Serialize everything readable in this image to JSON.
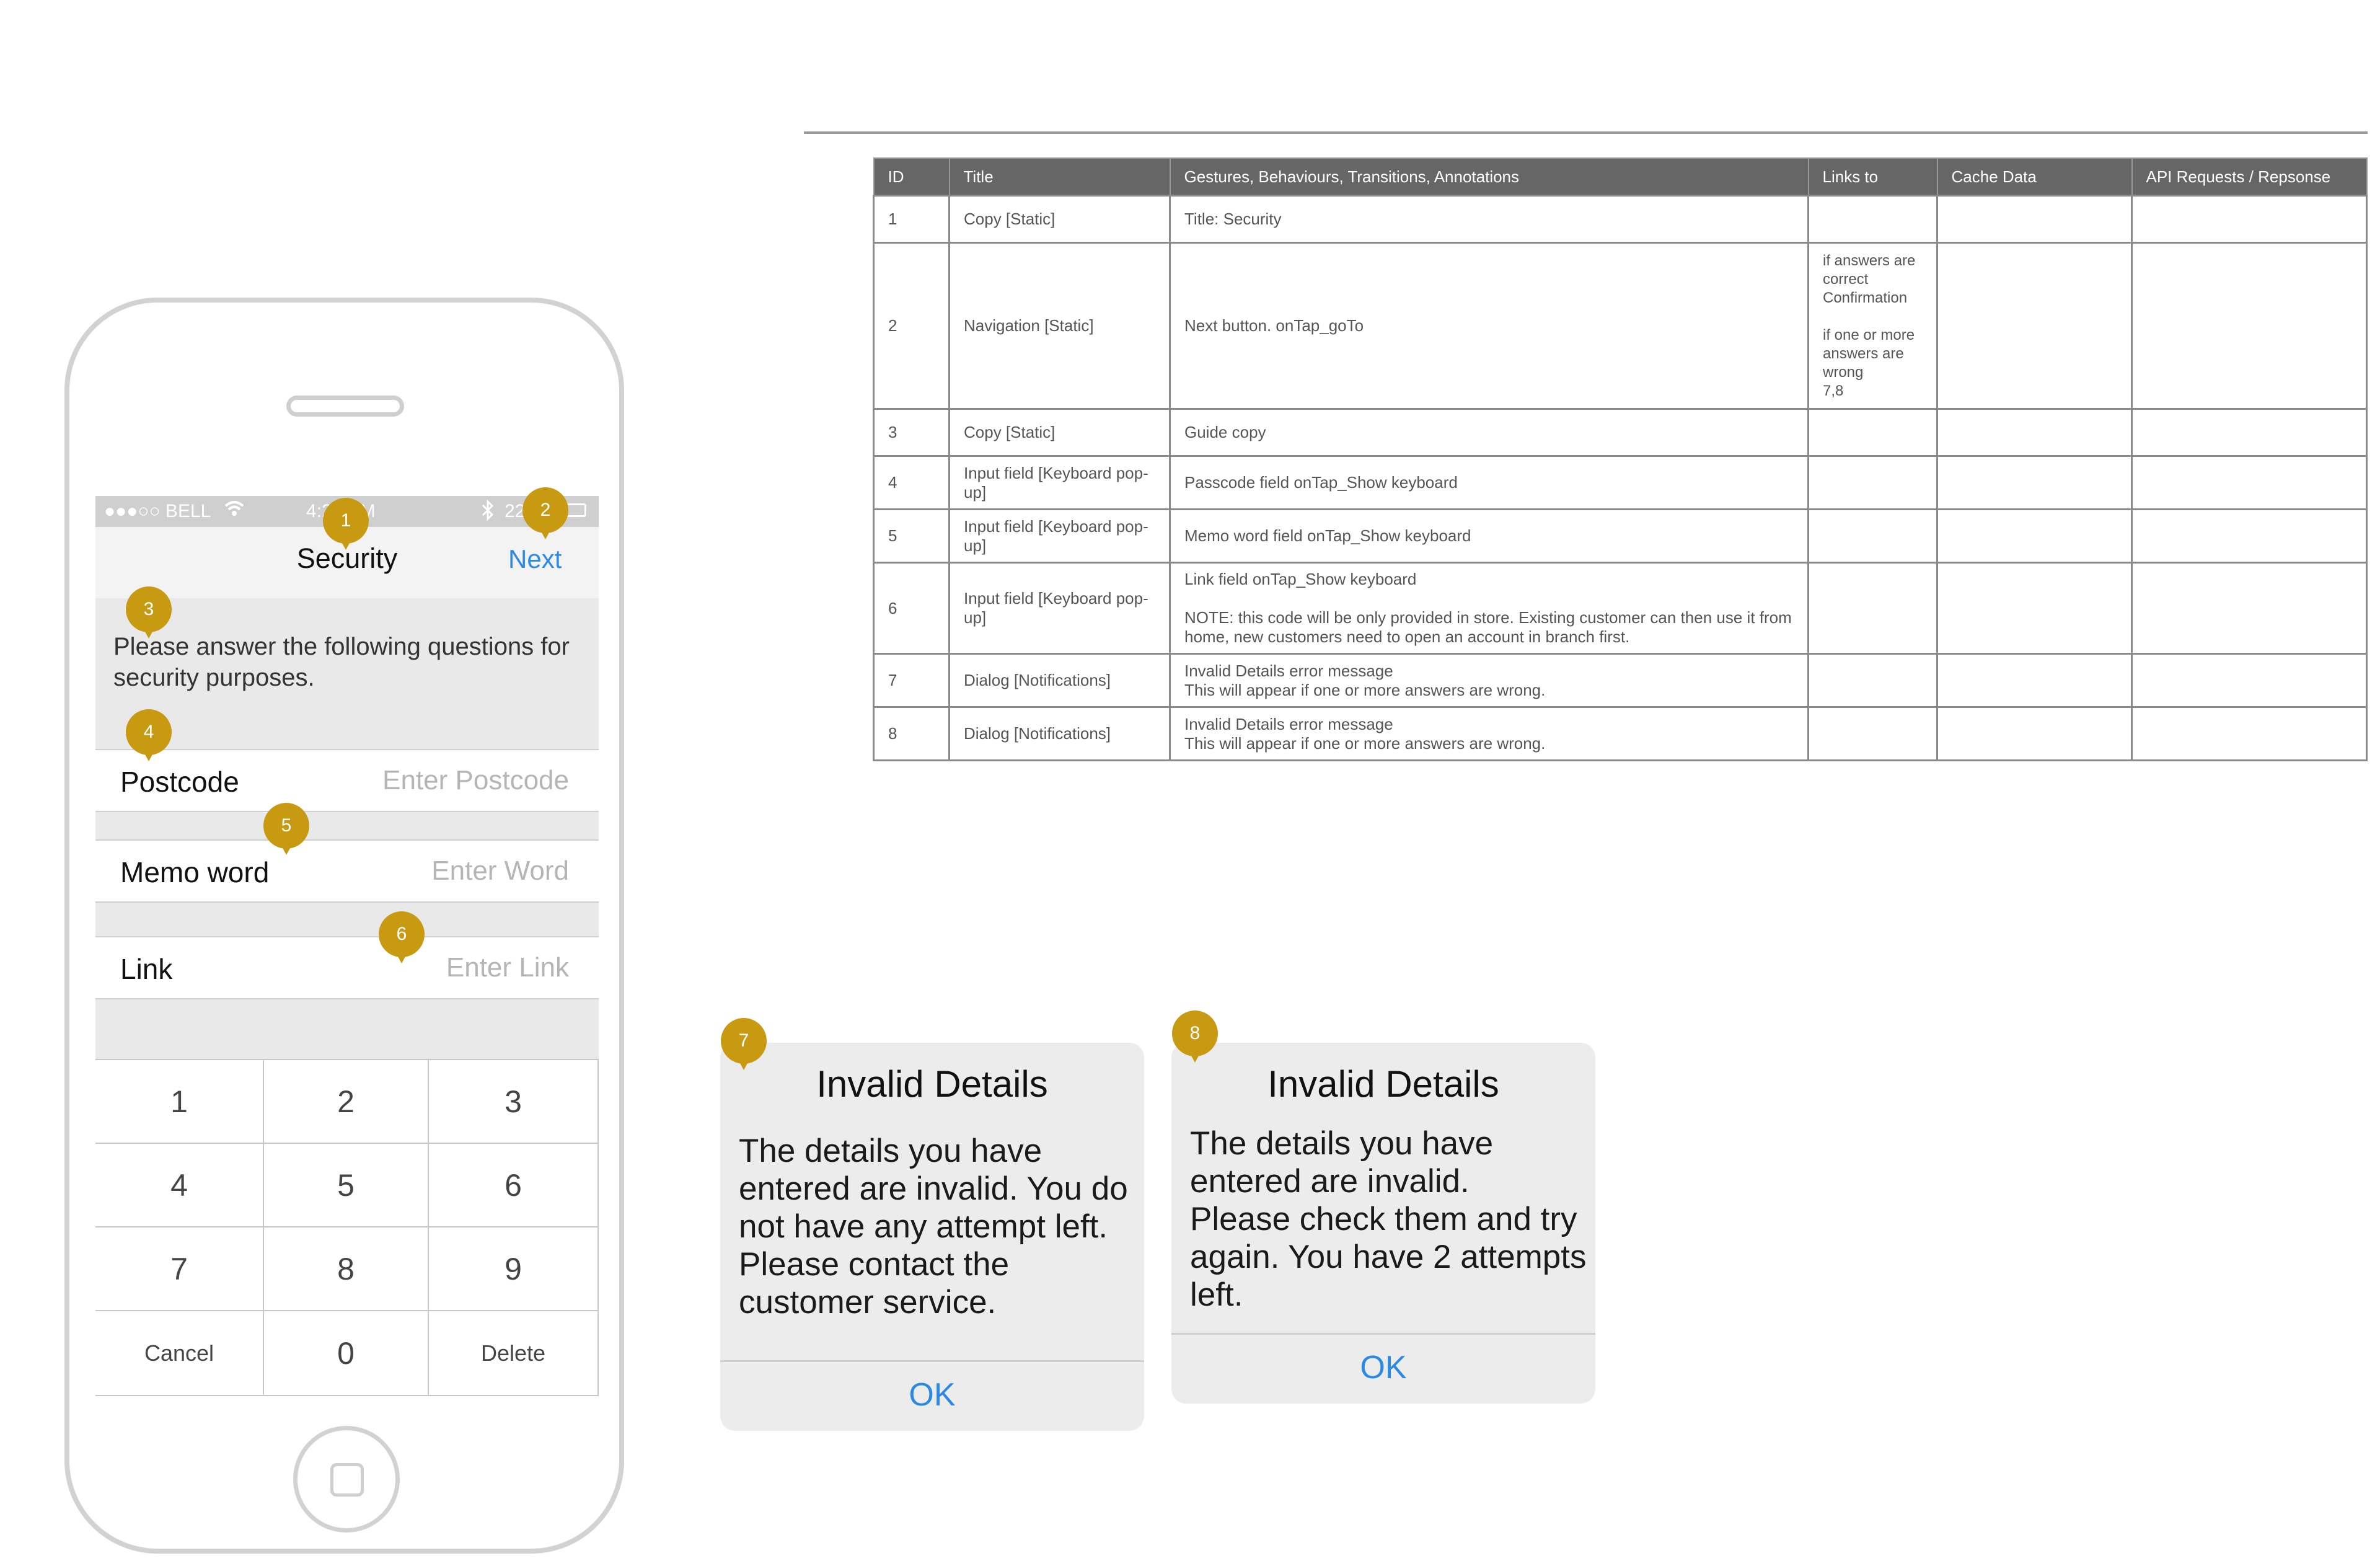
{
  "phone": {
    "status": {
      "carrier": "●●●○○ BELL",
      "time": "4:21 PM",
      "battery": "22%"
    },
    "nav": {
      "title": "Security",
      "next_label": "Next"
    },
    "guide_text": "Please answer the following questions for security purposes.",
    "fields": [
      {
        "label": "Postcode",
        "placeholder": "Enter Postcode"
      },
      {
        "label": "Memo word",
        "placeholder": "Enter Word"
      },
      {
        "label": "Link",
        "placeholder": "Enter Link"
      }
    ],
    "keypad": {
      "k1": "1",
      "k2": "2",
      "k3": "3",
      "k4": "4",
      "k5": "5",
      "k6": "6",
      "k7": "7",
      "k8": "8",
      "k9": "9",
      "cancel": "Cancel",
      "k0": "0",
      "delete": "Delete"
    }
  },
  "markers": {
    "m1": "1",
    "m2": "2",
    "m3": "3",
    "m4": "4",
    "m5": "5",
    "m6": "6",
    "m7": "7",
    "m8": "8"
  },
  "table": {
    "headers": [
      "ID",
      "Title",
      "Gestures, Behaviours, Transitions, Annotations",
      "Links to",
      "Cache Data",
      "API Requests / Repsonse"
    ],
    "rows": [
      {
        "id": "1",
        "title": "Copy [Static]",
        "desc": "Title: Security",
        "links": ""
      },
      {
        "id": "2",
        "title": "Navigation [Static]",
        "desc": "Next button. onTap_goTo",
        "links": "if answers are correct\nConfirmation\n\nif one or more answers are wrong\n7,8"
      },
      {
        "id": "3",
        "title": "Copy [Static]",
        "desc": "Guide copy",
        "links": ""
      },
      {
        "id": "4",
        "title": "Input field [Keyboard pop-up]",
        "desc": "Passcode field onTap_Show keyboard",
        "links": ""
      },
      {
        "id": "5",
        "title": "Input field [Keyboard pop-up]",
        "desc": "Memo word field onTap_Show keyboard",
        "links": ""
      },
      {
        "id": "6",
        "title": "Input field [Keyboard pop-up]",
        "desc": "Link field onTap_Show keyboard\n\nNOTE: this code will be only provided in store. Existing customer can then use it from home, new customers need to open an account in branch first.",
        "links": ""
      },
      {
        "id": "7",
        "title": "Dialog [Notifications]",
        "desc": "Invalid Details error message\nThis will appear if one or more answers are wrong.",
        "links": ""
      },
      {
        "id": "8",
        "title": "Dialog [Notifications]",
        "desc": "Invalid Details error message\nThis will appear if one or more answers are wrong.",
        "links": ""
      }
    ]
  },
  "dialogs": [
    {
      "title": "Invalid Details",
      "body": "The details you have\nentered are invalid. You do\nnot have any attempt left.\nPlease contact the\ncustomer service.",
      "ok": "OK"
    },
    {
      "title": "Invalid Details",
      "body": "The details you have\nentered are invalid.\nPlease check them and try\nagain. You have 2 attempts\nleft.",
      "ok": "OK"
    }
  ],
  "colors": {
    "accent": "#2b89e6",
    "marker": "#c79a12",
    "table_header": "#666666"
  }
}
